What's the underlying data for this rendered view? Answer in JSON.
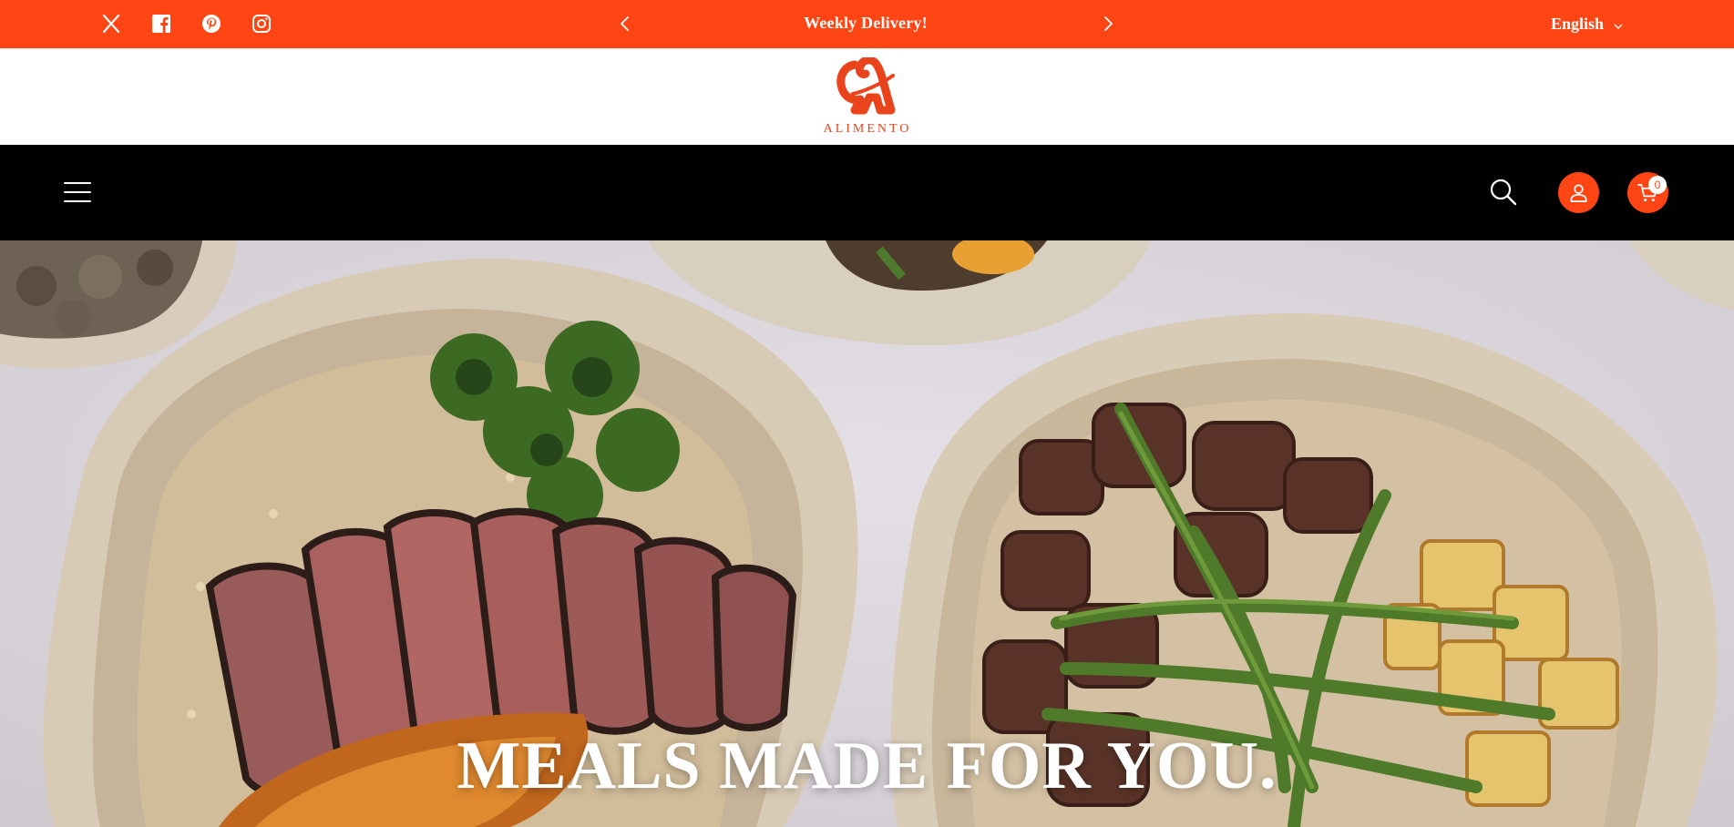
{
  "colors": {
    "brand": "#ff4514",
    "header_bg": "#000000",
    "announcement_text": "#ffffff",
    "logo_text": "#e9441c"
  },
  "announcement": {
    "message": "Weekly Delivery!",
    "prev_icon": "chevron-left-icon",
    "next_icon": "chevron-right-icon",
    "social_icons": [
      "x-twitter-icon",
      "facebook-icon",
      "pinterest-icon",
      "instagram-icon"
    ],
    "language": "English"
  },
  "logo": {
    "wordmark": "ALIMENTO",
    "monogram": "A"
  },
  "header": {
    "menu_icon": "hamburger-menu-icon",
    "search_icon": "search-icon",
    "account_icon": "user-icon",
    "cart_icon": "cart-icon",
    "cart_count": "0"
  },
  "hero": {
    "headline": "MEALS MADE FOR YOU."
  }
}
